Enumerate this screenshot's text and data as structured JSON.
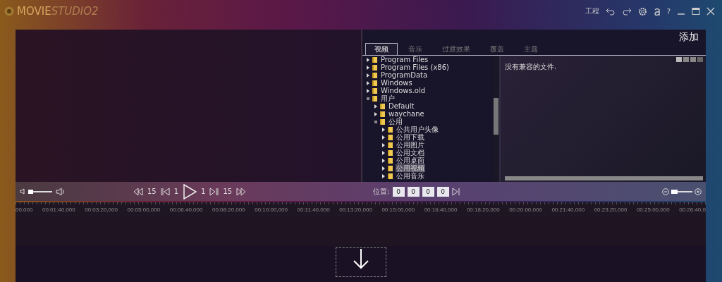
{
  "title_bar": {
    "logo": {
      "word_1": "MOVIE",
      "word_2": "STUDIO2"
    },
    "project_label": "工程",
    "help_label": "?"
  },
  "add_panel": {
    "heading": "添加",
    "tabs": [
      {
        "label": "视频",
        "selected": true
      },
      {
        "label": "音乐",
        "selected": false
      },
      {
        "label": "过渡效果",
        "selected": false
      },
      {
        "label": "覆盖",
        "selected": false
      },
      {
        "label": "主题",
        "selected": false
      }
    ],
    "tree": [
      {
        "label": "Program Files",
        "expanded": false
      },
      {
        "label": "Program Files (x86)",
        "expanded": false
      },
      {
        "label": "ProgramData",
        "expanded": false
      },
      {
        "label": "Windows",
        "expanded": false
      },
      {
        "label": "Windows.old",
        "expanded": false
      },
      {
        "label": "用户",
        "expanded": true,
        "children": [
          {
            "label": "Default",
            "expanded": false
          },
          {
            "label": "waychane",
            "expanded": false
          },
          {
            "label": "公用",
            "expanded": true,
            "children": [
              {
                "label": "公共用户头像",
                "expanded": false,
                "selected": false
              },
              {
                "label": "公用下载",
                "expanded": false,
                "selected": false
              },
              {
                "label": "公用图片",
                "expanded": false,
                "selected": false
              },
              {
                "label": "公用文档",
                "expanded": false,
                "selected": false
              },
              {
                "label": "公用桌面",
                "expanded": false,
                "selected": false
              },
              {
                "label": "公用视频",
                "expanded": false,
                "selected": true
              },
              {
                "label": "公用音乐",
                "expanded": false,
                "selected": false
              }
            ]
          }
        ]
      }
    ],
    "empty_message": "没有兼容的文件."
  },
  "transport": {
    "volume": {
      "level": 0.2
    },
    "rewind_step": "15",
    "back_step": "1",
    "forward_step": "1",
    "fast_forward_step": "15",
    "position_label": "位置:",
    "position_fields": [
      "0",
      "0",
      "0",
      "0"
    ],
    "zoom": {
      "level": 0.3
    }
  },
  "ruler": [
    "00,000",
    "00:01:40,000",
    "00:03:20,000",
    "00:05:00,000",
    "00:06:40,000",
    "00:08:20,000",
    "00:10:00,000",
    "00:11:40,000",
    "00:13:20,000",
    "00:15:00,000",
    "00:16:40,000",
    "00:18:20,000",
    "00:20:00,000",
    "00:21:40,000",
    "00:23:20,000",
    "00:25:00,000",
    "00:26:40,0"
  ]
}
